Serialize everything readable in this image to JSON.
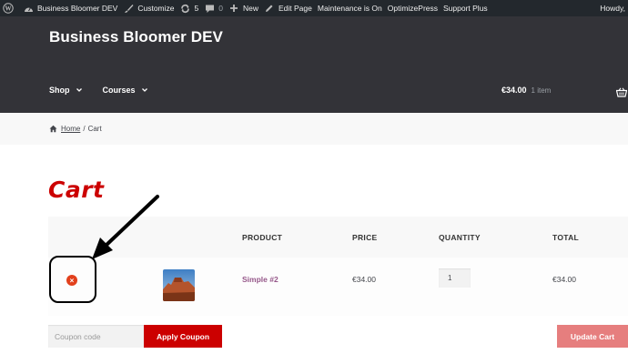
{
  "admin_bar": {
    "site_name": "Business Bloomer DEV",
    "customize": "Customize",
    "updates_count": "5",
    "comments_count": "0",
    "new": "New",
    "edit_page": "Edit Page",
    "maintenance": "Maintenance is On",
    "optimizepress": "OptimizePress",
    "support": "Support Plus",
    "howdy": "Howdy,"
  },
  "header": {
    "site_title": "Business Bloomer DEV",
    "nav": [
      {
        "label": "Shop"
      },
      {
        "label": "Courses"
      }
    ],
    "cart_amount": "€34.00",
    "cart_count": "1 item"
  },
  "breadcrumb": {
    "home": "Home",
    "separator": "/",
    "current": "Cart"
  },
  "page_title": "Cart",
  "table": {
    "headers": {
      "product": "PRODUCT",
      "price": "PRICE",
      "quantity": "QUANTITY",
      "total": "TOTAL"
    },
    "rows": [
      {
        "remove_glyph": "×",
        "product": "Simple #2",
        "price": "€34.00",
        "quantity": "1",
        "total": "€34.00"
      }
    ]
  },
  "actions": {
    "coupon_placeholder": "Coupon code",
    "apply": "Apply Coupon",
    "update": "Update Cart"
  },
  "colors": {
    "admin_bar": "#23282d",
    "header": "#333338",
    "accent_red": "#cc0000",
    "product_link": "#96588a",
    "remove": "#e2401c",
    "update_disabled": "#e67e7e"
  }
}
